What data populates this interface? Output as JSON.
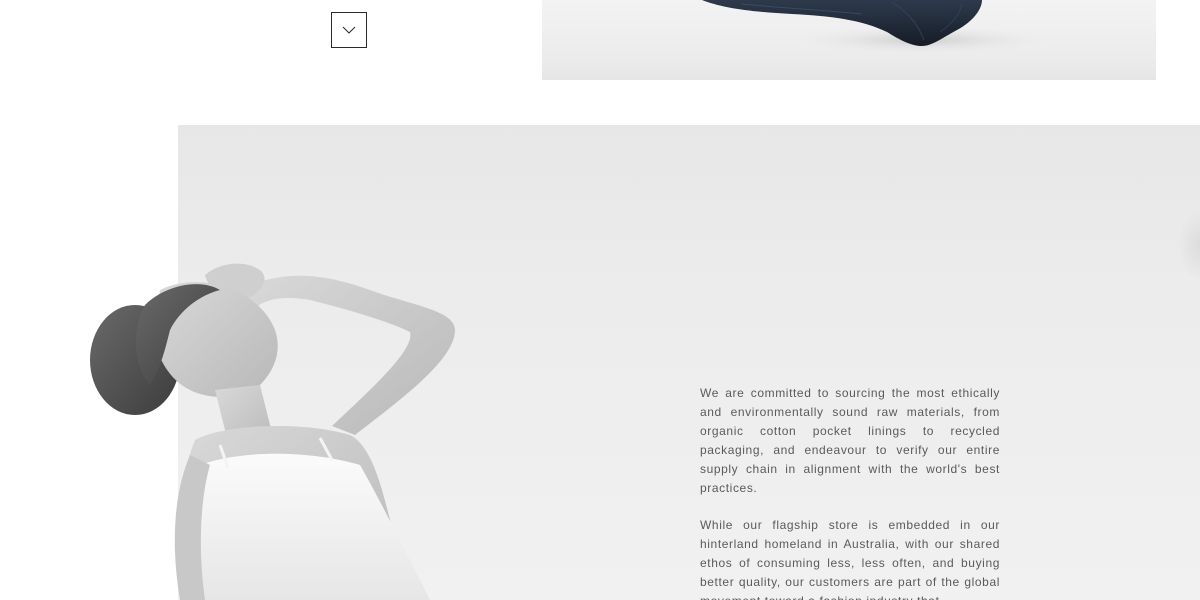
{
  "header": {
    "scroll_button_icon": "chevron-down-icon"
  },
  "top_image": {
    "subject": "denim-jeans"
  },
  "feature": {
    "image_subject": "model-portrait",
    "paragraphs": [
      "We are committed to sourcing the most ethically and environmentally sound raw materials, from organic cotton pocket linings to recycled packaging, and endeavour to verify our entire supply chain in alignment with the world's best practices.",
      "While our flagship store is embedded in our hinterland homeland in Australia, with our shared ethos of consuming less, less often, and buying better quality, our customers are part of the global movement toward a fashion industry that"
    ]
  },
  "colors": {
    "panel_background": "#ececec",
    "text": "#5a5a5a",
    "button_border": "#2a2a2a"
  }
}
